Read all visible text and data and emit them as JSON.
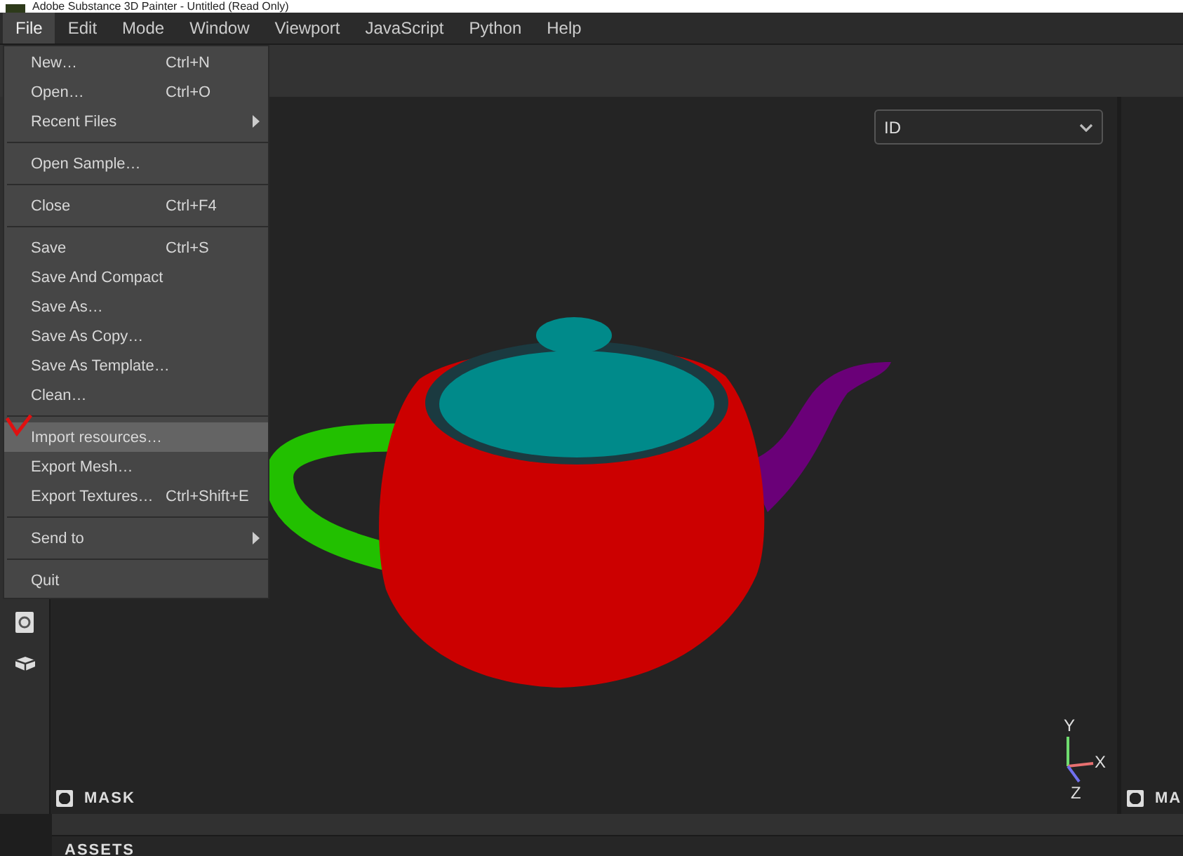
{
  "window": {
    "title": "Adobe Substance 3D Painter - Untitled (Read Only)"
  },
  "menubar": [
    {
      "label": "File",
      "selected": true
    },
    {
      "label": "Edit",
      "selected": false
    },
    {
      "label": "Mode",
      "selected": false
    },
    {
      "label": "Window",
      "selected": false
    },
    {
      "label": "Viewport",
      "selected": false
    },
    {
      "label": "JavaScript",
      "selected": false
    },
    {
      "label": "Python",
      "selected": false
    },
    {
      "label": "Help",
      "selected": false
    }
  ],
  "file_menu": [
    {
      "kind": "item",
      "label": "New…",
      "shortcut": "Ctrl+N",
      "submenu": false,
      "selected": false
    },
    {
      "kind": "item",
      "label": "Open…",
      "shortcut": "Ctrl+O",
      "submenu": false,
      "selected": false
    },
    {
      "kind": "item",
      "label": "Recent Files",
      "submenu": true,
      "selected": false
    },
    {
      "kind": "separator"
    },
    {
      "kind": "item",
      "label": "Open Sample…",
      "submenu": false,
      "selected": false
    },
    {
      "kind": "separator"
    },
    {
      "kind": "item",
      "label": "Close",
      "shortcut": "Ctrl+F4",
      "submenu": false,
      "selected": false
    },
    {
      "kind": "separator"
    },
    {
      "kind": "item",
      "label": "Save",
      "shortcut": "Ctrl+S",
      "submenu": false,
      "selected": false
    },
    {
      "kind": "item",
      "label": "Save And Compact",
      "submenu": false,
      "selected": false
    },
    {
      "kind": "item",
      "label": "Save As…",
      "submenu": false,
      "selected": false
    },
    {
      "kind": "item",
      "label": "Save As Copy…",
      "submenu": false,
      "selected": false
    },
    {
      "kind": "item",
      "label": "Save As Template…",
      "submenu": false,
      "selected": false
    },
    {
      "kind": "item",
      "label": "Clean…",
      "submenu": false,
      "selected": false
    },
    {
      "kind": "separator"
    },
    {
      "kind": "item",
      "label": "Import resources…",
      "submenu": false,
      "selected": true
    },
    {
      "kind": "item",
      "label": "Export Mesh…",
      "submenu": false,
      "selected": false
    },
    {
      "kind": "item",
      "label": "Export Textures…",
      "shortcut": "Ctrl+Shift+E",
      "submenu": false,
      "selected": false
    },
    {
      "kind": "separator"
    },
    {
      "kind": "item",
      "label": "Send to",
      "submenu": true,
      "selected": false
    },
    {
      "kind": "separator"
    },
    {
      "kind": "item",
      "label": "Quit",
      "submenu": false,
      "selected": false
    }
  ],
  "viewport": {
    "channel_dropdown": {
      "value": "ID"
    },
    "mask_label": "MASK",
    "axes": {
      "x": "X",
      "y": "Y",
      "z": "Z"
    }
  },
  "side_viewport": {
    "mask_label": "MA"
  },
  "bottom_panel": {
    "title": "ASSETS"
  }
}
